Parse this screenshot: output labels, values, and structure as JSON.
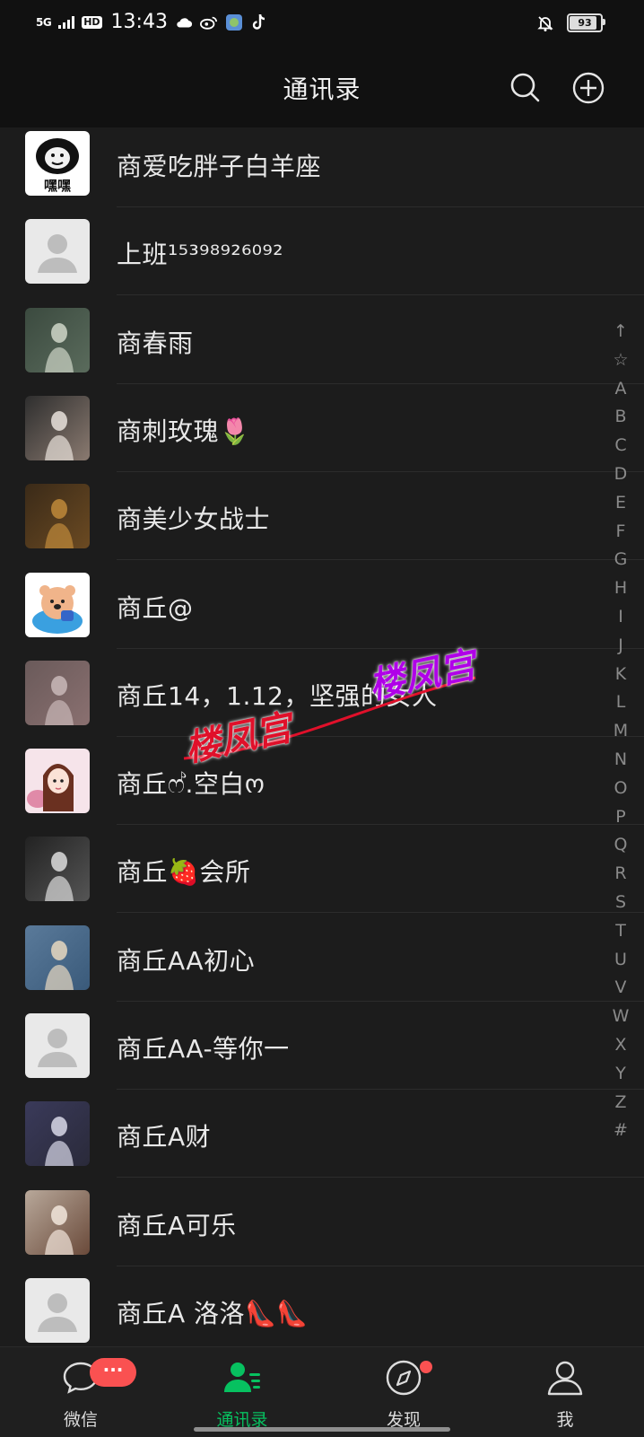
{
  "status_bar": {
    "network": "5G",
    "hd": "HD",
    "time": "13:43",
    "battery_level": 93,
    "battery_text": "93",
    "icons": [
      "cloud-icon",
      "weibo-icon",
      "globe-app-icon",
      "tiktok-icon",
      "bell-off-icon"
    ]
  },
  "header": {
    "title": "通讯录",
    "search_icon": "search-icon",
    "add_icon": "plus-circle-icon"
  },
  "contacts": [
    {
      "name": "商爱吃胖子白羊座",
      "avatar": "meme-face"
    },
    {
      "name": "上班¹⁵³⁹⁸⁹²⁶⁰⁹²",
      "avatar": "default"
    },
    {
      "name": "商春雨",
      "avatar": "photo"
    },
    {
      "name": "商刺玫瑰🌷",
      "avatar": "photo"
    },
    {
      "name": "商美少女战士",
      "avatar": "photo"
    },
    {
      "name": "商丘@",
      "avatar": "cartoon-bear"
    },
    {
      "name": "商丘14，1.12，坚强的女人",
      "avatar": "photo"
    },
    {
      "name": "商丘ෆ්.空白ო",
      "avatar": "anime-girl"
    },
    {
      "name": "商丘🍓会所",
      "avatar": "photo"
    },
    {
      "name": "商丘AA初心",
      "avatar": "photo"
    },
    {
      "name": "商丘AA-等你一",
      "avatar": "default"
    },
    {
      "name": "商丘A财",
      "avatar": "photo"
    },
    {
      "name": "商丘A可乐",
      "avatar": "photo"
    },
    {
      "name": "商丘A 洛洛👠👠",
      "avatar": "default"
    }
  ],
  "avatar_text": {
    "meme_caption": "嘿嘿"
  },
  "alpha_index": [
    "↑",
    "☆",
    "A",
    "B",
    "C",
    "D",
    "E",
    "F",
    "G",
    "H",
    "I",
    "J",
    "K",
    "L",
    "M",
    "N",
    "O",
    "P",
    "Q",
    "R",
    "S",
    "T",
    "U",
    "V",
    "W",
    "X",
    "Y",
    "Z",
    "#"
  ],
  "watermark": {
    "text_red": "楼凤宫",
    "text_purple": "楼凤宫"
  },
  "tab_bar": {
    "tabs": [
      {
        "label": "微信",
        "icon": "chat-bubble-icon",
        "active": false
      },
      {
        "label": "通讯录",
        "icon": "contacts-icon",
        "active": true
      },
      {
        "label": "发现",
        "icon": "compass-icon",
        "active": false
      },
      {
        "label": "我",
        "icon": "person-icon",
        "active": false
      }
    ],
    "chat_badge": "···"
  },
  "colors": {
    "accent": "#07c160",
    "badge": "#fa5151",
    "background": "#1c1c1c",
    "header": "#111111"
  }
}
